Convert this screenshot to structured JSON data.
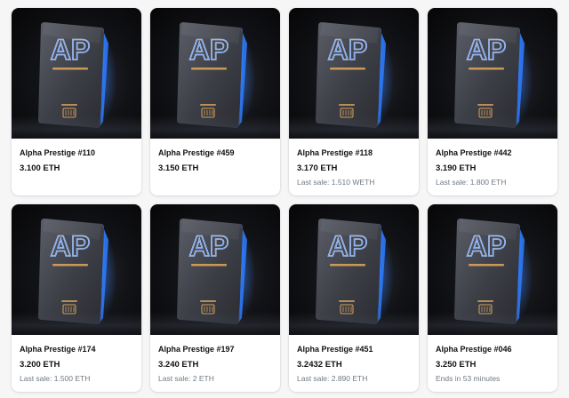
{
  "accent_colors": {
    "card_glow": "#2f7cff",
    "logo_gold": "#d9a35a",
    "text_primary": "#121212",
    "text_secondary": "#707a83"
  },
  "cards": [
    {
      "name": "Alpha Prestige #110",
      "price": "3.100 ETH",
      "sub": "",
      "image": "metal-card-image"
    },
    {
      "name": "Alpha Prestige #459",
      "price": "3.150 ETH",
      "sub": "",
      "image": "metal-card-image"
    },
    {
      "name": "Alpha Prestige #118",
      "price": "3.170 ETH",
      "sub": "Last sale: 1.510 WETH",
      "image": "metal-card-image"
    },
    {
      "name": "Alpha Prestige #442",
      "price": "3.190 ETH",
      "sub": "Last sale: 1.800 ETH",
      "image": "metal-card-image"
    },
    {
      "name": "Alpha Prestige #174",
      "price": "3.200 ETH",
      "sub": "Last sale: 1.500 ETH",
      "image": "metal-card-image"
    },
    {
      "name": "Alpha Prestige #197",
      "price": "3.240 ETH",
      "sub": "Last sale: 2 ETH",
      "image": "metal-card-image"
    },
    {
      "name": "Alpha Prestige #451",
      "price": "3.2432 ETH",
      "sub": "Last sale: 2.890 ETH",
      "image": "metal-card-image"
    },
    {
      "name": "Alpha Prestige #046",
      "price": "3.250 ETH",
      "sub": "Ends in 53 minutes",
      "image": "metal-card-image"
    }
  ]
}
